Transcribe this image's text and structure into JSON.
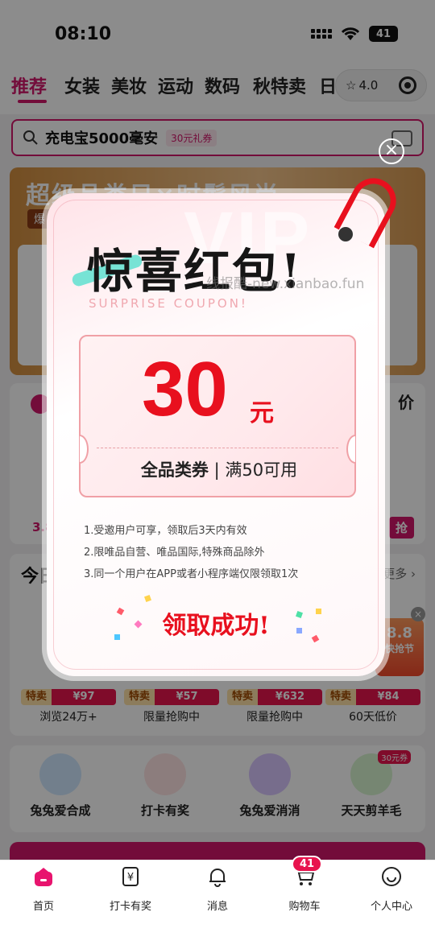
{
  "status_bar": {
    "time": "08:10",
    "battery": "41"
  },
  "category_tabs": [
    "推荐",
    "女装",
    "美妆",
    "运动",
    "数码",
    "秋特卖",
    "日"
  ],
  "mini_program": {
    "rating": "4.0"
  },
  "search": {
    "query": "充电宝5000毫安",
    "tag": "30元礼券"
  },
  "banner": {
    "title": "超级品类日×时髦风尚",
    "sub": "爆"
  },
  "section_a": {
    "price_label": "价",
    "price": "3.8",
    "grab": "抢"
  },
  "section_b": {
    "title": "今日",
    "more": "更多 ›",
    "ad_value": "8.8",
    "ad_text": "快抢节",
    "deals": [
      {
        "tag": "特卖",
        "price": "¥97",
        "caption": "浏览24万+"
      },
      {
        "tag": "特卖",
        "price": "¥57",
        "caption": "限量抢购中"
      },
      {
        "tag": "特卖",
        "price": "¥632",
        "caption": "限量抢购中"
      },
      {
        "tag": "特卖",
        "price": "¥84",
        "caption": "60天低价"
      }
    ]
  },
  "games": [
    {
      "label": "兔兔爱合成",
      "color": "#cfe8ff"
    },
    {
      "label": "打卡有奖",
      "color": "#ffe3e3"
    },
    {
      "label": "兔兔爱消消",
      "color": "#d9c6ff"
    },
    {
      "label": "天天剪羊毛",
      "color": "#d8f5d0",
      "badge": "30元券"
    }
  ],
  "popup": {
    "watermark": "VIP",
    "title": "惊喜红包!",
    "subtitle": "SURPRISE COUPON!",
    "site_watermark": "线报酷-new.xianbao.fun",
    "amount": "30",
    "unit": "元",
    "desc_main": "全品类券",
    "desc_sep": "|",
    "desc_cond": "满50可用",
    "rules": [
      "1.受邀用户可享，领取后3天内有效",
      "2.限唯品自营、唯品国际,特殊商品除外",
      "3.同一个用户在APP或者小程序端仅限领取1次"
    ],
    "success": "领取成功!",
    "close_symbol": "×"
  },
  "bottom_nav": [
    {
      "label": "首页",
      "icon": "home-icon",
      "active": true
    },
    {
      "label": "打卡有奖",
      "icon": "checkin-icon"
    },
    {
      "label": "消息",
      "icon": "bell-icon"
    },
    {
      "label": "购物车",
      "icon": "cart-icon",
      "badge": "41"
    },
    {
      "label": "个人中心",
      "icon": "profile-icon"
    }
  ],
  "colors": {
    "brand": "#d1166b",
    "coupon_red": "#e8101e"
  }
}
